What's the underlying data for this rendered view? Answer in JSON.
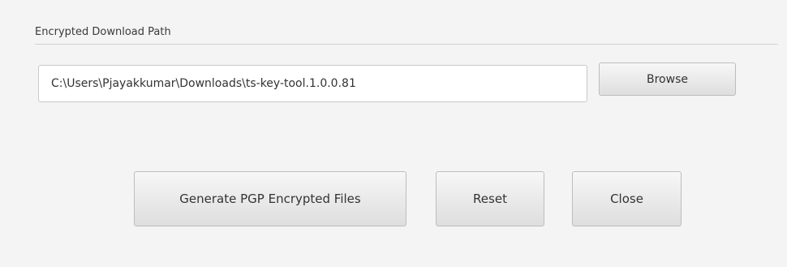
{
  "download_section": {
    "title": "Encrypted Download Path",
    "path_value": "C:\\Users\\Pjayakkumar\\Downloads\\ts-key-tool.1.0.0.81",
    "browse_label": "Browse"
  },
  "actions": {
    "generate_label": "Generate PGP Encrypted Files",
    "reset_label": "Reset",
    "close_label": "Close"
  }
}
